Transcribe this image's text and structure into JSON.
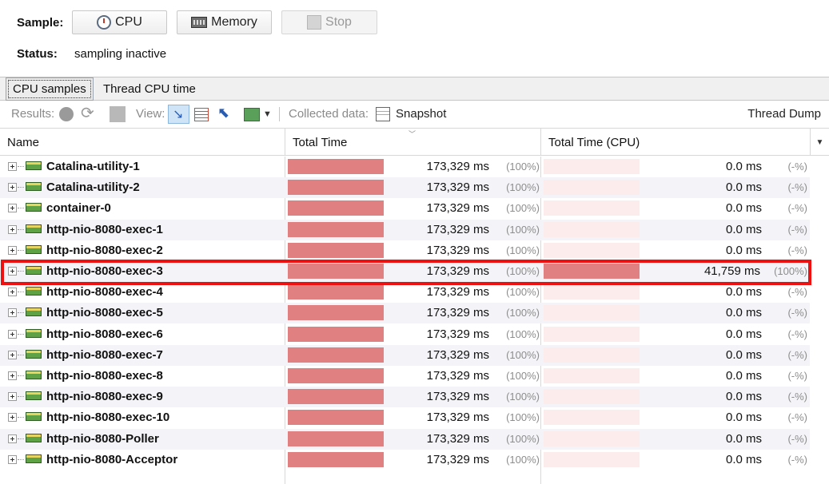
{
  "controls": {
    "sample_label": "Sample:",
    "cpu_button": "CPU",
    "memory_button": "Memory",
    "stop_button": "Stop",
    "status_label": "Status:",
    "status_value": "sampling inactive"
  },
  "tabs": [
    {
      "label": "CPU samples",
      "selected": true
    },
    {
      "label": "Thread CPU time",
      "selected": false
    }
  ],
  "results_bar": {
    "results_label": "Results:",
    "view_label": "View:",
    "collected_label": "Collected data:",
    "snapshot_label": "Snapshot",
    "thread_dump_label": "Thread Dump"
  },
  "table": {
    "columns": [
      "Name",
      "Total Time",
      "Total Time (CPU)"
    ],
    "highlighted_row": 5,
    "highlight_color": "#ee1111",
    "bar_color": "#e08080",
    "rows": [
      {
        "name": "Catalina-utility-1",
        "total": "173,329 ms",
        "total_pct": "(100%)",
        "total_fill": 1,
        "cpu": "0.0 ms",
        "cpu_pct": "(-%)",
        "cpu_fill": 0
      },
      {
        "name": "Catalina-utility-2",
        "total": "173,329 ms",
        "total_pct": "(100%)",
        "total_fill": 1,
        "cpu": "0.0 ms",
        "cpu_pct": "(-%)",
        "cpu_fill": 0
      },
      {
        "name": "container-0",
        "total": "173,329 ms",
        "total_pct": "(100%)",
        "total_fill": 1,
        "cpu": "0.0 ms",
        "cpu_pct": "(-%)",
        "cpu_fill": 0
      },
      {
        "name": "http-nio-8080-exec-1",
        "total": "173,329 ms",
        "total_pct": "(100%)",
        "total_fill": 1,
        "cpu": "0.0 ms",
        "cpu_pct": "(-%)",
        "cpu_fill": 0
      },
      {
        "name": "http-nio-8080-exec-2",
        "total": "173,329 ms",
        "total_pct": "(100%)",
        "total_fill": 1,
        "cpu": "0.0 ms",
        "cpu_pct": "(-%)",
        "cpu_fill": 0
      },
      {
        "name": "http-nio-8080-exec-3",
        "total": "173,329 ms",
        "total_pct": "(100%)",
        "total_fill": 1,
        "cpu": "41,759 ms",
        "cpu_pct": "(100%)",
        "cpu_fill": 1
      },
      {
        "name": "http-nio-8080-exec-4",
        "total": "173,329 ms",
        "total_pct": "(100%)",
        "total_fill": 1,
        "cpu": "0.0 ms",
        "cpu_pct": "(-%)",
        "cpu_fill": 0
      },
      {
        "name": "http-nio-8080-exec-5",
        "total": "173,329 ms",
        "total_pct": "(100%)",
        "total_fill": 1,
        "cpu": "0.0 ms",
        "cpu_pct": "(-%)",
        "cpu_fill": 0
      },
      {
        "name": "http-nio-8080-exec-6",
        "total": "173,329 ms",
        "total_pct": "(100%)",
        "total_fill": 1,
        "cpu": "0.0 ms",
        "cpu_pct": "(-%)",
        "cpu_fill": 0
      },
      {
        "name": "http-nio-8080-exec-7",
        "total": "173,329 ms",
        "total_pct": "(100%)",
        "total_fill": 1,
        "cpu": "0.0 ms",
        "cpu_pct": "(-%)",
        "cpu_fill": 0
      },
      {
        "name": "http-nio-8080-exec-8",
        "total": "173,329 ms",
        "total_pct": "(100%)",
        "total_fill": 1,
        "cpu": "0.0 ms",
        "cpu_pct": "(-%)",
        "cpu_fill": 0
      },
      {
        "name": "http-nio-8080-exec-9",
        "total": "173,329 ms",
        "total_pct": "(100%)",
        "total_fill": 1,
        "cpu": "0.0 ms",
        "cpu_pct": "(-%)",
        "cpu_fill": 0
      },
      {
        "name": "http-nio-8080-exec-10",
        "total": "173,329 ms",
        "total_pct": "(100%)",
        "total_fill": 1,
        "cpu": "0.0 ms",
        "cpu_pct": "(-%)",
        "cpu_fill": 0
      },
      {
        "name": "http-nio-8080-Poller",
        "total": "173,329 ms",
        "total_pct": "(100%)",
        "total_fill": 1,
        "cpu": "0.0 ms",
        "cpu_pct": "(-%)",
        "cpu_fill": 0
      },
      {
        "name": "http-nio-8080-Acceptor",
        "total": "173,329 ms",
        "total_pct": "(100%)",
        "total_fill": 1,
        "cpu": "0.0 ms",
        "cpu_pct": "(-%)",
        "cpu_fill": 0
      }
    ]
  },
  "icons": [
    "clock-icon",
    "memory-chip-icon",
    "stop-icon",
    "gc-icon",
    "refresh-icon",
    "warning-icon",
    "call-tree-icon",
    "hotspots-icon",
    "back-traces-icon",
    "combined-icon",
    "dropdown-icon",
    "snapshot-icon",
    "expand-icon",
    "thread-icon",
    "sort-indicator-icon",
    "column-menu-icon"
  ]
}
